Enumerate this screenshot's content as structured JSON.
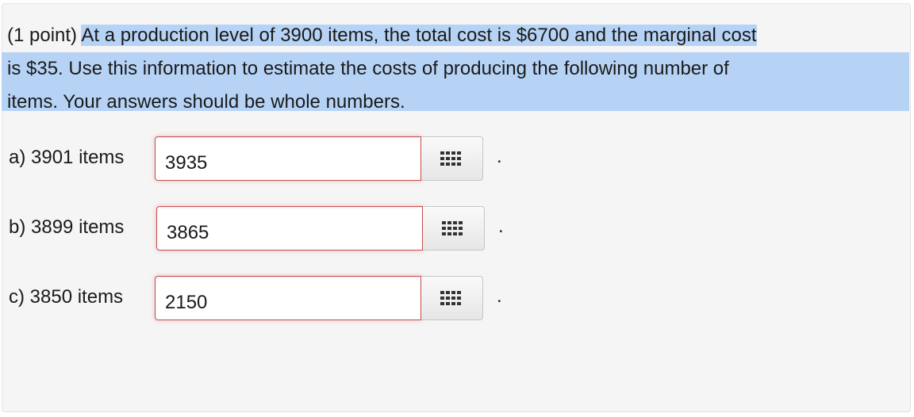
{
  "problem": {
    "points": "(1 point)",
    "line1": "At a production level of 3900 items, the total cost is $6700 and the marginal cost",
    "line2": "is $35. Use this information to estimate the costs of producing the following number of",
    "line3": "items. Your answers should be whole numbers."
  },
  "answers": [
    {
      "label": "a) 3901 items",
      "value": "3935",
      "suffix": "."
    },
    {
      "label": "b) 3899 items",
      "value": "3865",
      "suffix": "."
    },
    {
      "label": "c) 3850 items",
      "value": "2150",
      "suffix": "."
    }
  ],
  "icons": {
    "keypad": "keypad-grid-icon"
  },
  "colors": {
    "highlight": "#b6d3f6",
    "panel_bg": "#f5f5f5",
    "error_border": "#c9504f"
  }
}
